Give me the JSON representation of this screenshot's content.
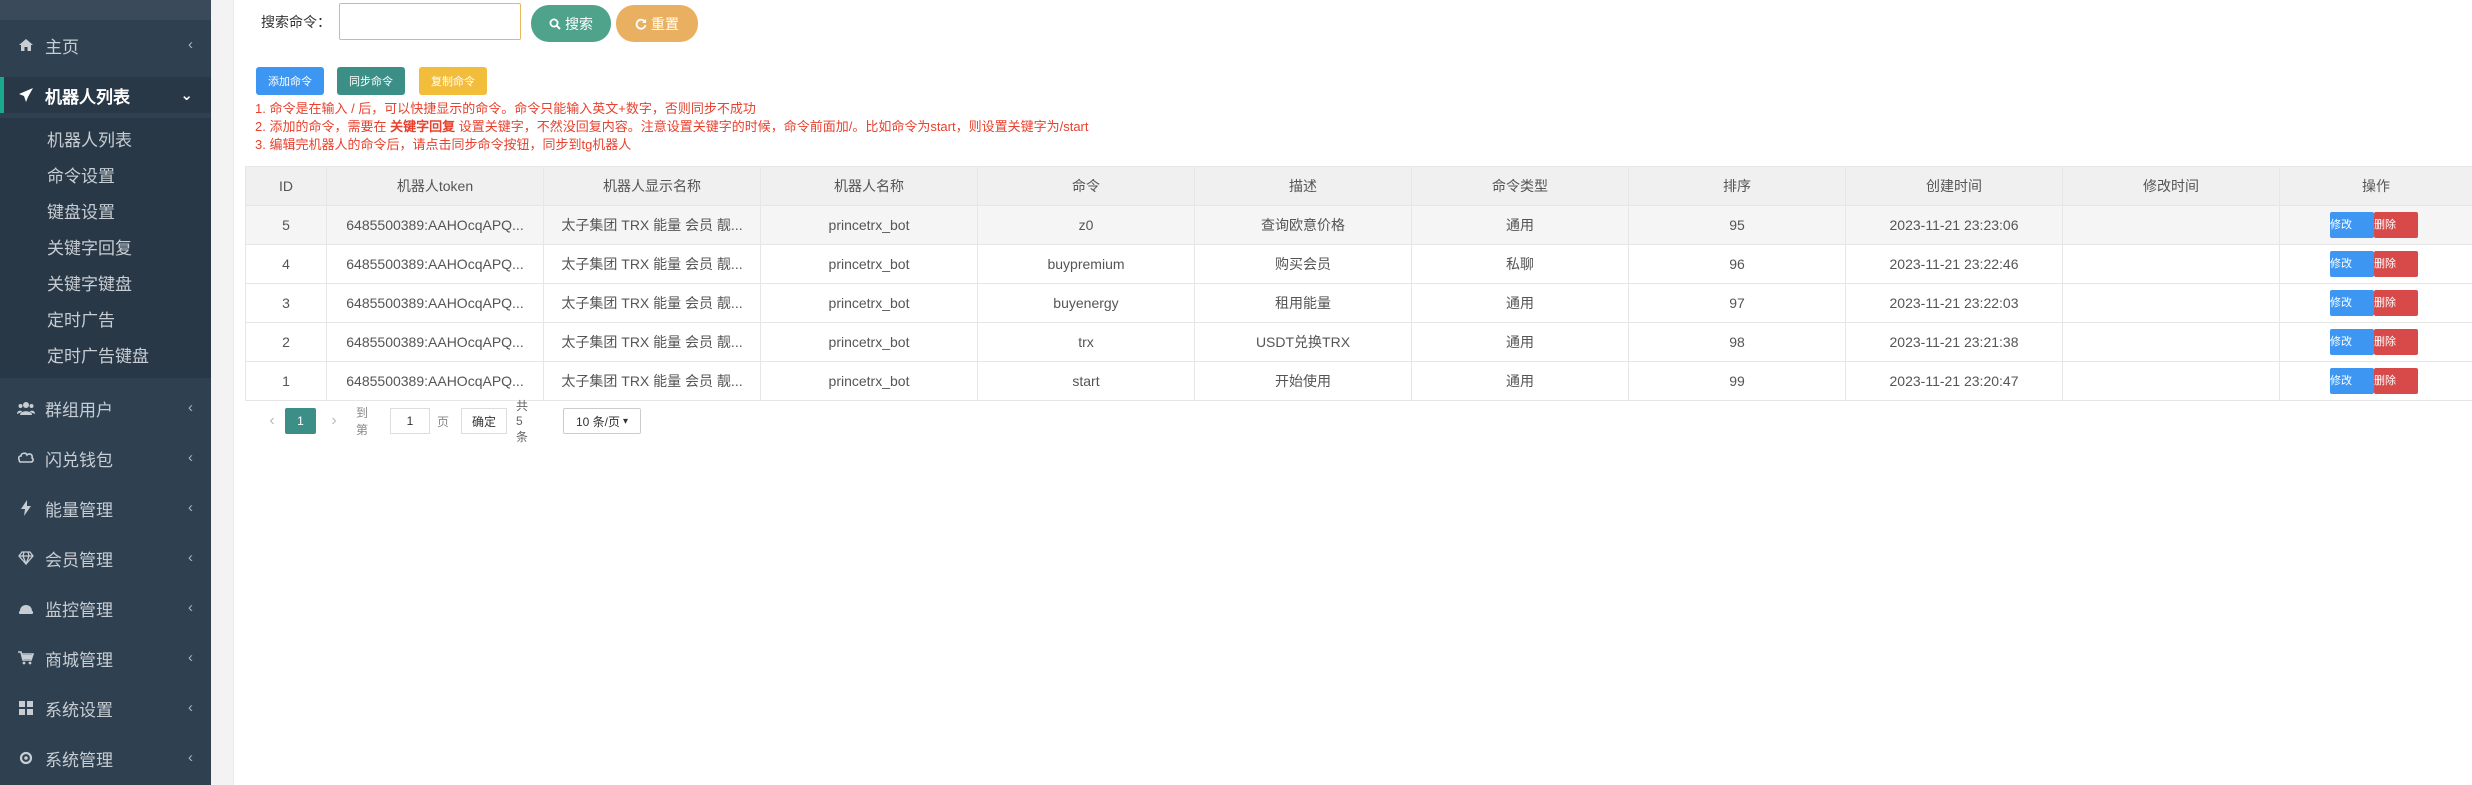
{
  "sidebar": {
    "items": [
      {
        "label": "主页",
        "icon": "home-icon"
      },
      {
        "label": "机器人列表",
        "icon": "plane-icon"
      },
      {
        "label": "群组用户",
        "icon": "users-icon"
      },
      {
        "label": "闪兑钱包",
        "icon": "wallet-icon"
      },
      {
        "label": "能量管理",
        "icon": "bolt-icon"
      },
      {
        "label": "会员管理",
        "icon": "diamond-icon"
      },
      {
        "label": "监控管理",
        "icon": "monitor-icon"
      },
      {
        "label": "商城管理",
        "icon": "cart-icon"
      },
      {
        "label": "系统设置",
        "icon": "windows-icon"
      },
      {
        "label": "系统管理",
        "icon": "gear-icon"
      }
    ],
    "submenu": [
      "机器人列表",
      "命令设置",
      "键盘设置",
      "关键字回复",
      "关键字键盘",
      "定时广告",
      "定时广告键盘"
    ]
  },
  "search": {
    "label": "搜索命令：",
    "placeholder": "",
    "value": "",
    "search_button": "搜索",
    "reset_button": "重置"
  },
  "toolbar": {
    "add": "添加命令",
    "sync": "同步命令",
    "copy": "复制命令"
  },
  "notes": {
    "line1": "1. 命令是在输入 / 后，可以快捷显示的命令。命令只能输入英文+数字，否则同步不成功",
    "line2_pre": "2. 添加的命令，需要在 ",
    "line2_bold": "关键字回复",
    "line2_post": " 设置关键字，不然没回复内容。注意设置关键字的时候，命令前面加/。比如命令为start，则设置关键字为/start",
    "line3": "3. 编辑完机器人的命令后，请点击同步命令按钮，同步到tg机器人"
  },
  "table": {
    "headers": [
      "ID",
      "机器人token",
      "机器人显示名称",
      "机器人名称",
      "命令",
      "描述",
      "命令类型",
      "排序",
      "创建时间",
      "修改时间",
      "操作"
    ],
    "rows": [
      [
        "5",
        "6485500389:AAHOcqAPQ...",
        "太子集团 TRX 能量 会员 靓...",
        "princetrx_bot",
        "z0",
        "查询欧意价格",
        "通用",
        "95",
        "2023-11-21 23:23:06",
        ""
      ],
      [
        "4",
        "6485500389:AAHOcqAPQ...",
        "太子集团 TRX 能量 会员 靓...",
        "princetrx_bot",
        "buypremium",
        "购买会员",
        "私聊",
        "96",
        "2023-11-21 23:22:46",
        ""
      ],
      [
        "3",
        "6485500389:AAHOcqAPQ...",
        "太子集团 TRX 能量 会员 靓...",
        "princetrx_bot",
        "buyenergy",
        "租用能量",
        "通用",
        "97",
        "2023-11-21 23:22:03",
        ""
      ],
      [
        "2",
        "6485500389:AAHOcqAPQ...",
        "太子集团 TRX 能量 会员 靓...",
        "princetrx_bot",
        "trx",
        "USDT兑换TRX",
        "通用",
        "98",
        "2023-11-21 23:21:38",
        ""
      ],
      [
        "1",
        "6485500389:AAHOcqAPQ...",
        "太子集团 TRX 能量 会员 靓...",
        "princetrx_bot",
        "start",
        "开始使用",
        "通用",
        "99",
        "2023-11-21 23:20:47",
        ""
      ]
    ],
    "edit_label": "修改",
    "delete_label": "删除"
  },
  "pager": {
    "current": "1",
    "goto_label": "到第",
    "goto_value": "1",
    "page_unit": "页",
    "ok_label": "确定",
    "total": "共 5 条",
    "page_size": "10 条/页"
  }
}
